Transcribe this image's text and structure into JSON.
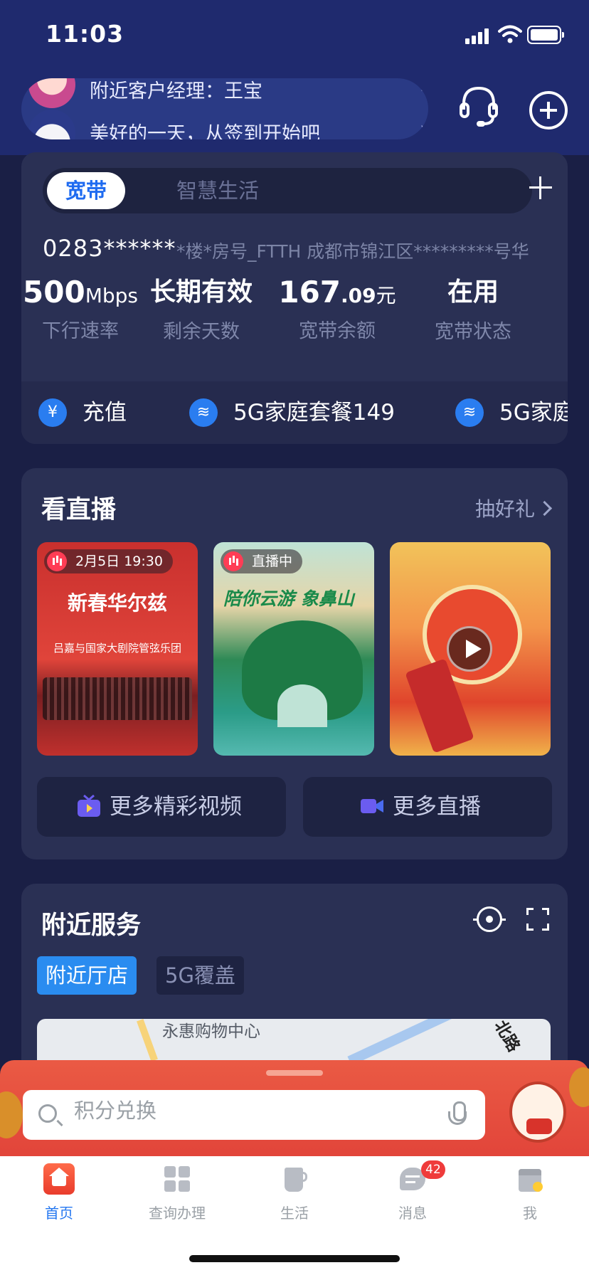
{
  "status_bar": {
    "time": "11:03"
  },
  "header": {
    "notices": [
      "附近客户经理：王宝",
      "美好的一天，从签到开始吧"
    ]
  },
  "broadband": {
    "tabs": [
      "宽带",
      "智慧生活"
    ],
    "account": "0283******",
    "address": "*楼*房号_FTTH   成都市锦江区*********号华",
    "stats": [
      {
        "value": "500",
        "unit": "Mbps",
        "label": "下行速率"
      },
      {
        "value": "长期有效",
        "unit": "",
        "label": "剩余天数"
      },
      {
        "value": "167",
        "decimal": ".09",
        "unit": "元",
        "label": "宽带余额"
      },
      {
        "value": "在用",
        "unit": "",
        "label": "宽带状态"
      }
    ],
    "quick_actions": [
      {
        "label": "充值",
        "icon": "yuan-icon"
      },
      {
        "label": "5G家庭套餐149",
        "icon": "wifi-icon"
      },
      {
        "label": "5G家庭",
        "icon": "wifi-icon"
      }
    ]
  },
  "live": {
    "title": "看直播",
    "more": "抽好礼",
    "items": [
      {
        "badge": "2月5日 19:30",
        "title": "新春华尔兹",
        "subtitle": "吕嘉与国家大剧院管弦乐团"
      },
      {
        "badge": "直播中",
        "title": "陪你云游 象鼻山"
      },
      {
        "badge": "",
        "title": ""
      }
    ],
    "buttons": [
      "更多精彩视频",
      "更多直播"
    ]
  },
  "nearby": {
    "title": "附近服务",
    "tabs": [
      "附近厅店",
      "5G覆盖"
    ],
    "map_labels": [
      "永惠购物中心",
      "北路"
    ]
  },
  "search": {
    "placeholder": "积分兑换"
  },
  "tabbar": {
    "items": [
      {
        "label": "首页",
        "active": true
      },
      {
        "label": "查询办理",
        "active": false
      },
      {
        "label": "生活",
        "active": false
      },
      {
        "label": "消息",
        "active": false,
        "badge": "42"
      },
      {
        "label": "我",
        "active": false
      }
    ]
  },
  "colors": {
    "header": "#1f2a6e",
    "background": "#1a1f45",
    "card": "#2a3054",
    "accent": "#2477f0",
    "near_tab_active": "#2a8cf0",
    "sheet": "#e2453a",
    "badge_red": "#ef3b3b"
  }
}
